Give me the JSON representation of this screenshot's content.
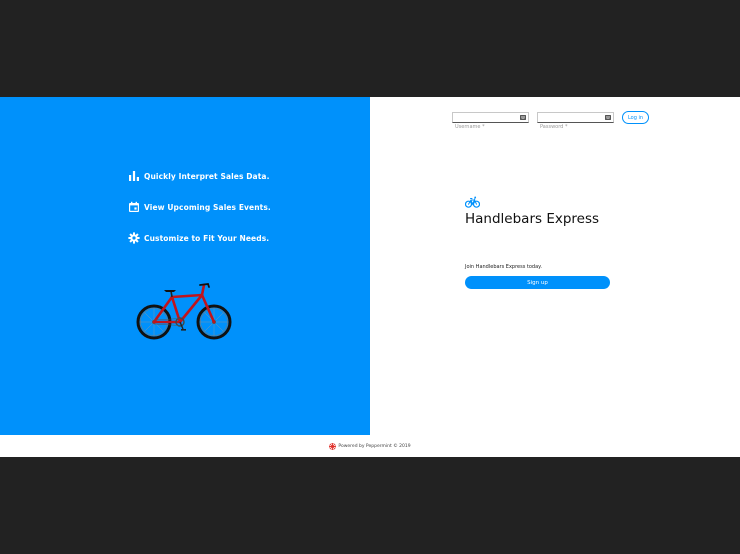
{
  "features": [
    {
      "icon": "bar-chart-icon",
      "label": "Quickly Interpret Sales Data."
    },
    {
      "icon": "calendar-icon",
      "label": "View Upcoming Sales Events."
    },
    {
      "icon": "gear-icon",
      "label": "Customize to Fit Your Needs."
    }
  ],
  "login": {
    "username_placeholder": "Username *",
    "password_placeholder": "Password *",
    "login_label": "Log in"
  },
  "brand": {
    "icon": "bicycle-icon",
    "title": "Handlebars Express"
  },
  "signup": {
    "prompt": "Join Handlebars Express today.",
    "button_label": "Sign up"
  },
  "footer": {
    "icon": "peppermint-logo-icon",
    "text": "Powered by Peppermint © 2019"
  },
  "colors": {
    "accent": "#0091fb",
    "letterbox": "#222222",
    "bike_frame": "#c0141c"
  }
}
